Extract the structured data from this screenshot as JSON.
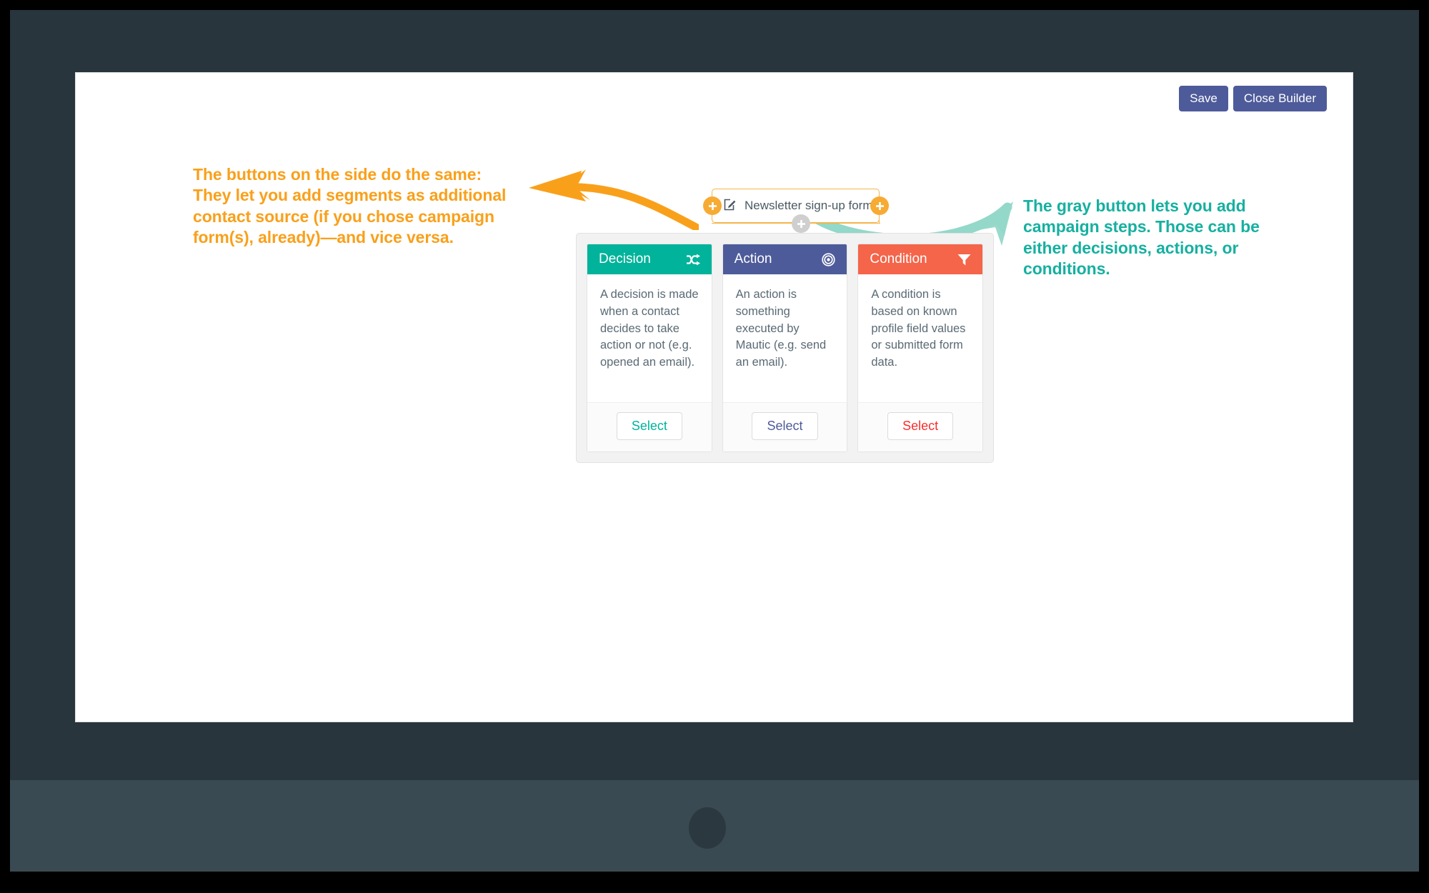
{
  "device": {
    "frame_color": "#29353c",
    "base_color": "#3a4a52",
    "home_button": "home-button"
  },
  "toolbar": {
    "save_label": "Save",
    "close_builder_label": "Close Builder",
    "button_color": "#4e5b9a"
  },
  "annotations": {
    "left": {
      "text": "The buttons on the side do the same: They let you add segments as additional contact source (if you chose campaign form(s), already)—and vice versa.",
      "color": "#f9a01b",
      "arrow": "curved-arrow-left"
    },
    "right": {
      "text": "The gray button lets you add campaign steps. Those can be either decisions, actions, or conditions.",
      "color": "#16b0a0",
      "arrow": "curved-arrow-right-up"
    }
  },
  "campaign": {
    "source_node": {
      "label": "Newsletter sign-up form",
      "icon": "form-edit-icon",
      "border_color": "#f5b44a",
      "plus_left": "+",
      "plus_right": "+",
      "plus_bottom": "+",
      "plus_color": "#f7ab32",
      "plus_bottom_color": "#cfcfcf"
    },
    "picker": {
      "cards": [
        {
          "title": "Decision",
          "icon": "shuffle-icon",
          "header_color": "#00b39a",
          "description": "A decision is made when a contact decides to take action or not (e.g. opened an email).",
          "select_label": "Select",
          "select_color": "#00b39a"
        },
        {
          "title": "Action",
          "icon": "target-icon",
          "header_color": "#4e5b9a",
          "description": "An action is something executed by Mautic (e.g. send an email).",
          "select_label": "Select",
          "select_color": "#4e5b9a"
        },
        {
          "title": "Condition",
          "icon": "filter-icon",
          "header_color": "#f4654a",
          "description": "A condition is based on known profile field values or submitted form data.",
          "select_label": "Select",
          "select_color": "#f92d2d"
        }
      ]
    }
  }
}
